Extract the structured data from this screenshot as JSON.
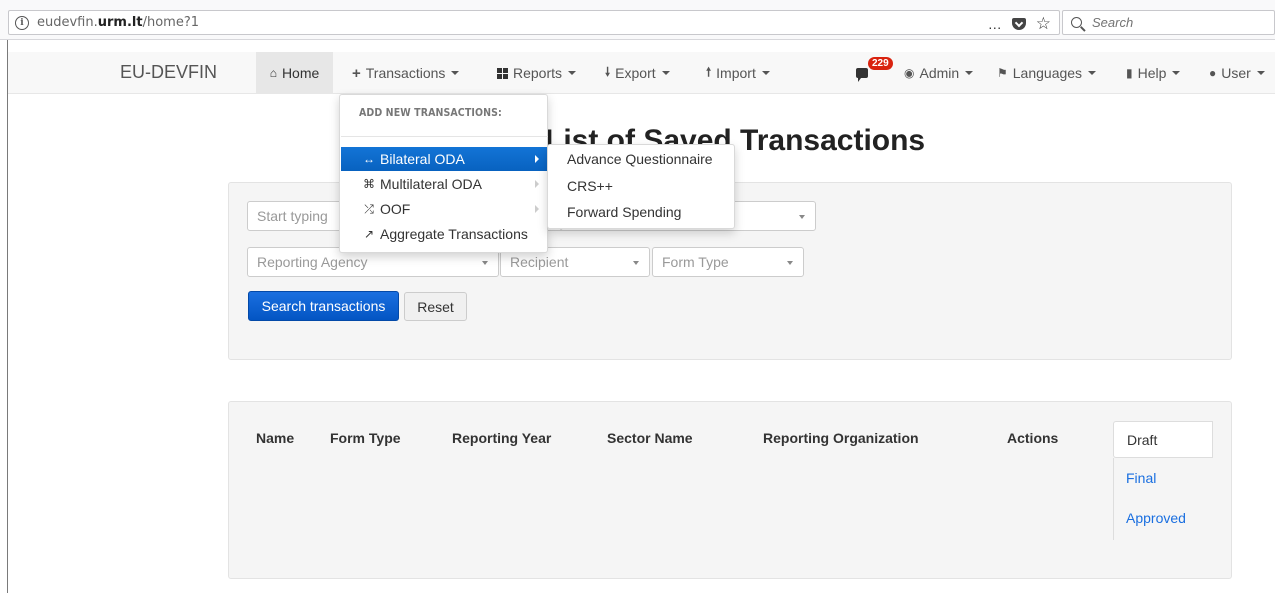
{
  "browser": {
    "url_prefix": "eudevfin.",
    "url_domain": "urm.lt",
    "url_path": "/home?1",
    "menu_dots": "…",
    "star": "☆",
    "search_placeholder": "Search"
  },
  "navbar": {
    "brand": "EU-DEVFIN",
    "items": {
      "home": "Home",
      "transactions": "Transactions",
      "reports": "Reports",
      "export": "Export",
      "import": "Import",
      "notifications_count": "229",
      "admin": "Admin",
      "languages": "Languages",
      "help": "Help",
      "user": "User"
    }
  },
  "page": {
    "title": "List of Saved Transactions"
  },
  "search": {
    "text_placeholder": "Start typing",
    "reporting_agency": "Reporting Agency",
    "recipient": "Recipient",
    "form_type": "Form Type",
    "search_button": "Search transactions",
    "reset_button": "Reset"
  },
  "results": {
    "columns": [
      "Name",
      "Form Type",
      "Reporting Year",
      "Sector Name",
      "Reporting Organization",
      "Actions"
    ],
    "status_tabs": [
      "Draft",
      "Final",
      "Approved"
    ]
  },
  "dropdown": {
    "header": "ADD NEW TRANSACTIONS:",
    "items": [
      {
        "label": "Bilateral ODA",
        "icon": "↔"
      },
      {
        "label": "Multilateral ODA",
        "icon": "⌘"
      },
      {
        "label": "OOF",
        "icon": "⤮"
      },
      {
        "label": "Aggregate Transactions",
        "icon": "↗"
      }
    ],
    "submenu": [
      "Advance Questionnaire",
      "CRS++",
      "Forward Spending"
    ]
  },
  "colors": {
    "primary": "#0a5fd0",
    "active_menu": "#0a6ac9",
    "badge": "#d9230f",
    "link": "#1a6fe0"
  }
}
